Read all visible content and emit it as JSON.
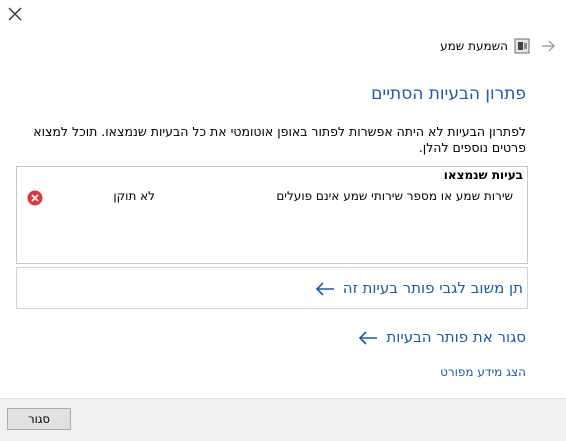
{
  "header": {
    "title": "השמעת שמע",
    "close_icon": "close-icon",
    "back_icon": "back-arrow-icon",
    "app_icon": "speaker-icon"
  },
  "main": {
    "heading": "פתרון הבעיות הסתיים",
    "description": "לפתרון הבעיות לא היתה אפשרות לפתור באופן אוטומטי את כל הבעיות שנמצאו. תוכל למצוא פרטים נוספים להלן.",
    "problems": {
      "title": "בעיות שנמצאו",
      "items": [
        {
          "text": "שירות שמע או מספר שירותי שמע אינם פועלים",
          "status": "לא תוקן",
          "status_icon": "error-icon"
        }
      ]
    },
    "feedback_link": "תן משוב לגבי פותר בעיות זה",
    "close_troubleshooter_link": "סגור את פותר הבעיות",
    "details_link": "הצג מידע מפורט"
  },
  "footer": {
    "close_button": "סגור"
  },
  "colors": {
    "link": "#1c5aa6",
    "error": "#e0373c",
    "footer_bg": "#f0f0f0"
  }
}
